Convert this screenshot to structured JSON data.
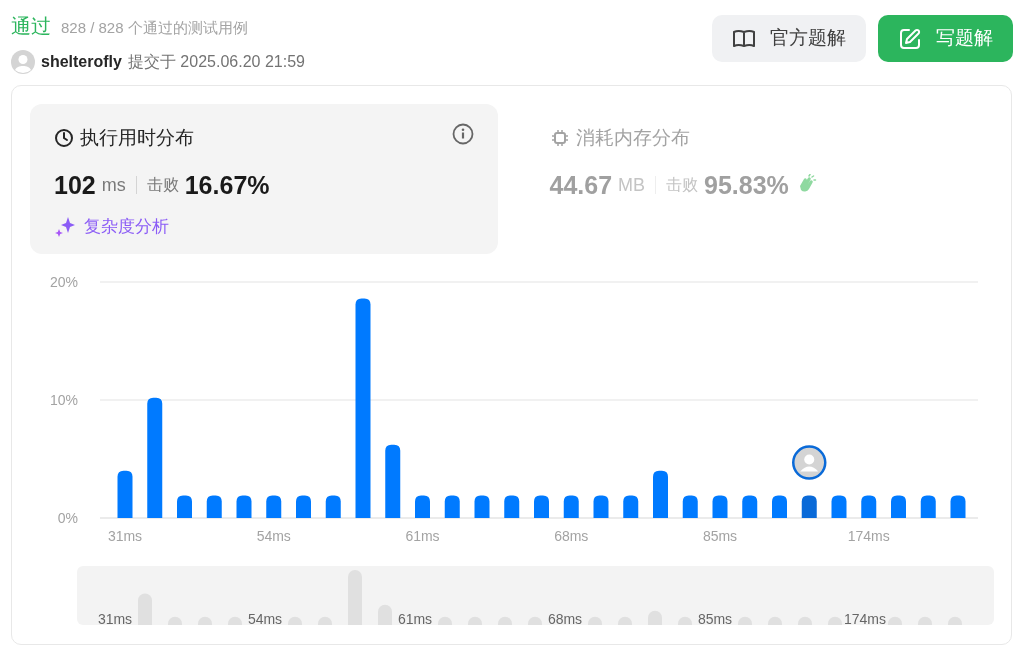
{
  "header": {
    "status": "通过",
    "summary": "828 / 828 个通过的测试用例",
    "user": "shelterofly",
    "submitted": "提交于 2025.06.20 21:59"
  },
  "buttons": [
    {
      "kind": "book",
      "label": "官方题解",
      "primary": false
    },
    {
      "kind": "edit",
      "label": "写题解",
      "primary": true
    }
  ],
  "metrics": [
    {
      "kind": "runtime",
      "title": "执行用时分布",
      "value": "102",
      "unit": "ms",
      "beats_label": "击败",
      "beats": "16.67%",
      "selected": true,
      "celebrate": false,
      "link": "复杂度分析"
    },
    {
      "kind": "memory",
      "title": "消耗内存分布",
      "value": "44.67",
      "unit": "MB",
      "beats_label": "击败",
      "beats": "95.83%",
      "selected": false,
      "celebrate": true
    }
  ],
  "chart_data": {
    "type": "bar",
    "ylim": [
      0,
      20
    ],
    "values": [
      4.0,
      10.2,
      1.9,
      1.9,
      1.9,
      1.9,
      1.9,
      1.9,
      18.6,
      6.2,
      1.9,
      1.9,
      1.9,
      1.9,
      1.9,
      1.9,
      1.9,
      1.9,
      4.0,
      1.9,
      1.9,
      1.9,
      1.9,
      1.9,
      1.9,
      1.9,
      1.9,
      1.9,
      1.9
    ],
    "yticks": [
      {
        "value": 0,
        "label": "0%"
      },
      {
        "value": 10,
        "label": "10%"
      },
      {
        "value": 20,
        "label": "20%"
      }
    ],
    "categories": [
      "31ms",
      null,
      null,
      null,
      null,
      "54ms",
      null,
      null,
      null,
      null,
      "61ms",
      null,
      null,
      null,
      null,
      "68ms",
      null,
      null,
      null,
      null,
      "85ms",
      null,
      null,
      null,
      null,
      "174ms",
      null,
      null,
      null
    ]
  },
  "bars": [
    {
      "selected": false
    },
    {
      "selected": false
    },
    {
      "selected": false
    },
    {
      "selected": false
    },
    {
      "selected": false
    },
    {
      "selected": false
    },
    {
      "selected": false
    },
    {
      "selected": false
    },
    {
      "selected": false
    },
    {
      "selected": false
    },
    {
      "selected": false
    },
    {
      "selected": false
    },
    {
      "selected": false
    },
    {
      "selected": false
    },
    {
      "selected": false
    },
    {
      "selected": false
    },
    {
      "selected": false
    },
    {
      "selected": false
    },
    {
      "selected": false
    },
    {
      "selected": false
    },
    {
      "selected": false
    },
    {
      "selected": false
    },
    {
      "selected": false
    },
    {
      "selected": true
    },
    {
      "selected": false
    },
    {
      "selected": false
    },
    {
      "selected": false
    },
    {
      "selected": false
    },
    {
      "selected": false
    }
  ],
  "navigator": {
    "labels": [
      "31ms",
      "54ms",
      "61ms",
      "68ms",
      "85ms",
      "174ms"
    ]
  }
}
